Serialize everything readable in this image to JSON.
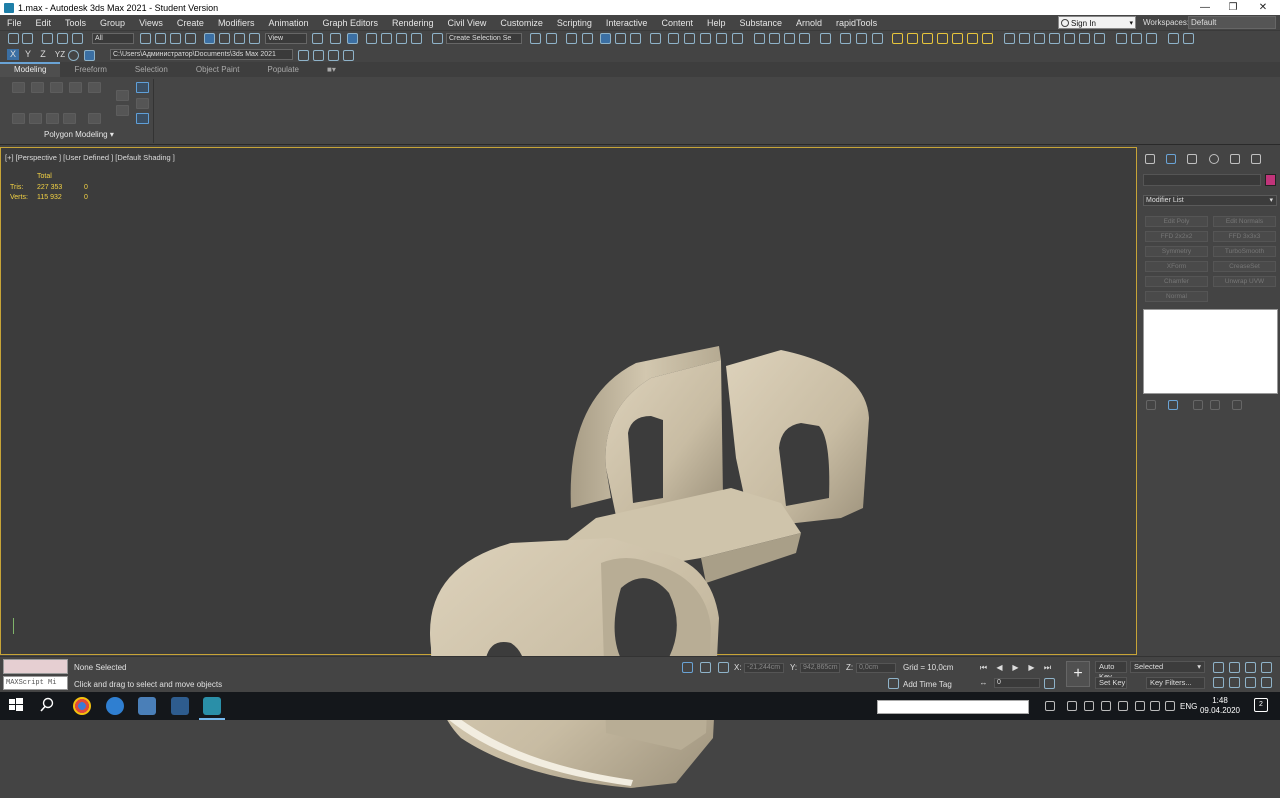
{
  "window": {
    "title": "1.max - Autodesk 3ds Max 2021 - Student Version",
    "minimize_icon": "minimize-icon",
    "restore_icon": "restore-icon",
    "close_icon": "close-icon"
  },
  "menubar": {
    "items": [
      "File",
      "Edit",
      "Tools",
      "Group",
      "Views",
      "Create",
      "Modifiers",
      "Animation",
      "Graph Editors",
      "Rendering",
      "Civil View",
      "Customize",
      "Scripting",
      "Interactive",
      "Content",
      "Help",
      "Substance",
      "Arnold",
      "rapidTools"
    ],
    "signin_label": "Sign In",
    "workspaces_label": "Workspaces:",
    "workspace_value": "Default"
  },
  "toolbar": {
    "selection_filter": "All",
    "reference_coord": "View",
    "named_selection": "Create Selection Se",
    "axis_x": "X",
    "axis_y": "Y",
    "axis_z": "Z",
    "axis_yz": "YZ",
    "project_path": "C:\\Users\\Администратор\\Documents\\3ds Max 2021"
  },
  "ribbon": {
    "tabs": [
      "Modeling",
      "Freeform",
      "Selection",
      "Object Paint",
      "Populate"
    ],
    "active_tab": "Modeling",
    "panel_label": "Polygon Modeling"
  },
  "viewport": {
    "label": "[+] [Perspective ] [User Defined ] [Default Shading ]",
    "stats_header": "Total",
    "tris_label": "Tris:",
    "tris_value": "227 353",
    "tris_sel": "0",
    "verts_label": "Verts:",
    "verts_value": "115 932",
    "verts_sel": "0"
  },
  "command_panel": {
    "modifier_list_label": "Modifier List",
    "object_color": "#c0347a",
    "modifier_buttons": [
      "Edit Poly",
      "Edit Normals",
      "FFD 2x2x2",
      "FFD 3x3x3",
      "Symmetry",
      "TurboSmooth",
      "XForm",
      "CreaseSet",
      "Chamfer",
      "Unwrap UVW",
      "Normal"
    ]
  },
  "statusbar": {
    "maxscript_label": "MAXScript Mi",
    "selection_status": "None Selected",
    "prompt": "Click and drag to select and move objects",
    "x_label": "X:",
    "x_value": "-21,244cm",
    "y_label": "Y:",
    "y_value": "942,865cm",
    "z_label": "Z:",
    "z_value": "0,0cm",
    "grid": "Grid = 10,0cm",
    "add_time_tag": "Add Time Tag",
    "auto_key": "Auto Key",
    "selected_dropdown": "Selected",
    "set_key": "Set Key",
    "key_filters": "Key Filters...",
    "frame_value": "0"
  },
  "taskbar": {
    "language": "ENG",
    "time": "1:48",
    "date": "09.04.2020",
    "notification_count": "2"
  }
}
